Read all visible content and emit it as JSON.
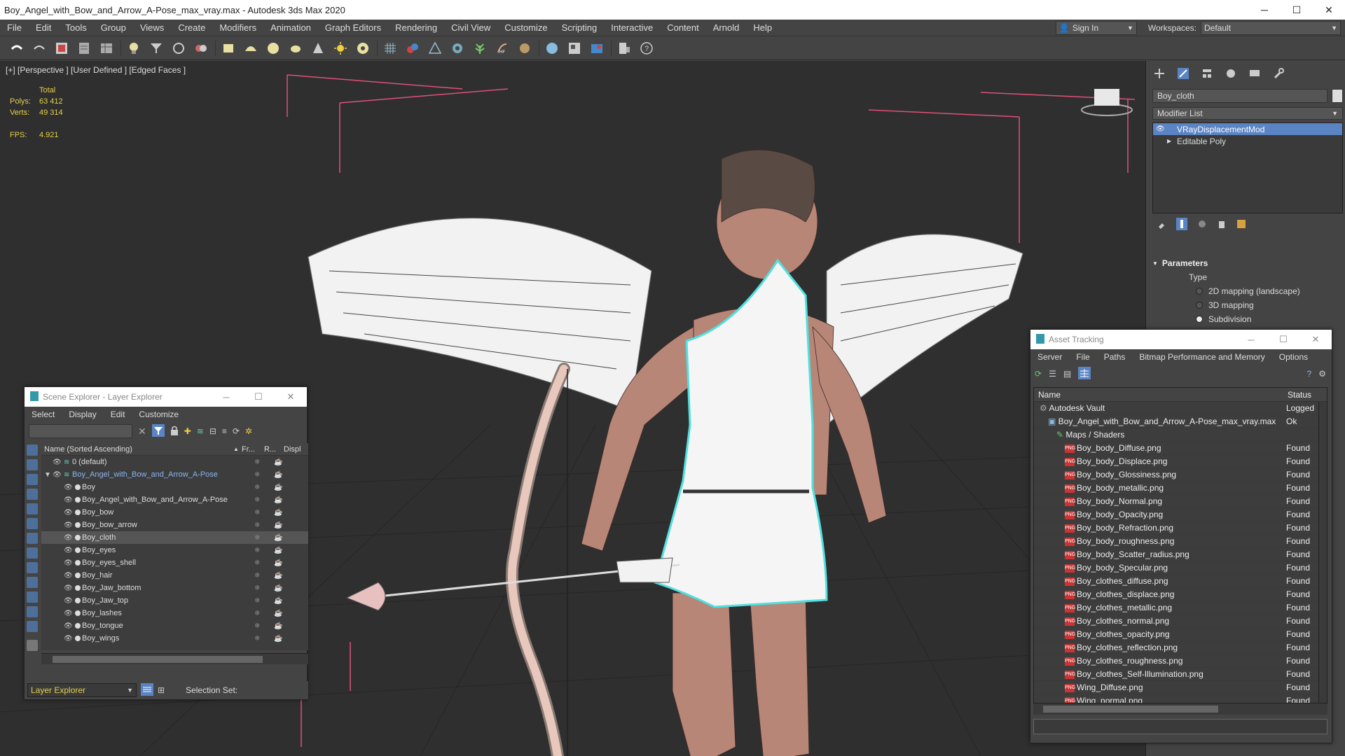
{
  "app": {
    "title": "Boy_Angel_with_Bow_and_Arrow_A-Pose_max_vray.max - Autodesk 3ds Max 2020",
    "minimize": "─",
    "maximize": "☐",
    "close": "✕"
  },
  "menubar": {
    "items": [
      "File",
      "Edit",
      "Tools",
      "Group",
      "Views",
      "Create",
      "Modifiers",
      "Animation",
      "Graph Editors",
      "Rendering",
      "Civil View",
      "Customize",
      "Scripting",
      "Interactive",
      "Content",
      "Arnold",
      "Help"
    ],
    "signin": "Sign In",
    "workspace_label": "Workspaces:",
    "workspace_value": "Default"
  },
  "viewport": {
    "label": "[+] [Perspective ] [User Defined ] [Edged Faces ]",
    "stats_total": "Total",
    "polys_label": "Polys:",
    "polys_value": "63 412",
    "verts_label": "Verts:",
    "verts_value": "49 314",
    "fps_label": "FPS:",
    "fps_value": "4.921"
  },
  "command_panel": {
    "object_name": "Boy_cloth",
    "modifier_list": "Modifier List",
    "stack": [
      "VRayDisplacementMod",
      "Editable Poly"
    ],
    "params_title": "Parameters",
    "type_label": "Type",
    "radios": [
      {
        "label": "2D mapping (landscape)",
        "on": false
      },
      {
        "label": "3D mapping",
        "on": false
      },
      {
        "label": "Subdivision",
        "on": true
      }
    ]
  },
  "scene_explorer": {
    "title": "Scene Explorer - Layer Explorer",
    "menu": [
      "Select",
      "Display",
      "Edit",
      "Customize"
    ],
    "col_name": "Name (Sorted Ascending)",
    "col_fr": "Fr...",
    "col_r": "R...",
    "col_disp": "Displ",
    "rows": [
      {
        "name": "0 (default)",
        "level": 0,
        "type": "layer"
      },
      {
        "name": "Boy_Angel_with_Bow_and_Arrow_A-Pose",
        "level": 0,
        "type": "layer-open"
      },
      {
        "name": "Boy",
        "level": 1,
        "type": "obj"
      },
      {
        "name": "Boy_Angel_with_Bow_and_Arrow_A-Pose",
        "level": 1,
        "type": "obj"
      },
      {
        "name": "Boy_bow",
        "level": 1,
        "type": "obj"
      },
      {
        "name": "Boy_bow_arrow",
        "level": 1,
        "type": "obj"
      },
      {
        "name": "Boy_cloth",
        "level": 1,
        "type": "obj-hl"
      },
      {
        "name": "Boy_eyes",
        "level": 1,
        "type": "obj"
      },
      {
        "name": "Boy_eyes_shell",
        "level": 1,
        "type": "obj"
      },
      {
        "name": "Boy_hair",
        "level": 1,
        "type": "obj"
      },
      {
        "name": "Boy_Jaw_bottom",
        "level": 1,
        "type": "obj"
      },
      {
        "name": "Boy_Jaw_top",
        "level": 1,
        "type": "obj"
      },
      {
        "name": "Boy_lashes",
        "level": 1,
        "type": "obj"
      },
      {
        "name": "Boy_tongue",
        "level": 1,
        "type": "obj"
      },
      {
        "name": "Boy_wings",
        "level": 1,
        "type": "obj"
      }
    ],
    "mode": "Layer Explorer",
    "selection_set": "Selection Set:"
  },
  "asset_tracking": {
    "title": "Asset Tracking",
    "menu": [
      "Server",
      "File",
      "Paths",
      "Bitmap Performance and Memory",
      "Options"
    ],
    "col_name": "Name",
    "col_status": "Status",
    "rows": [
      {
        "name": "Autodesk Vault",
        "status": "Logged",
        "level": 1,
        "icon": "vault"
      },
      {
        "name": "Boy_Angel_with_Bow_and_Arrow_A-Pose_max_vray.max",
        "status": "Ok",
        "level": 2,
        "icon": "max"
      },
      {
        "name": "Maps / Shaders",
        "status": "",
        "level": 3,
        "icon": "maps"
      },
      {
        "name": "Boy_body_Diffuse.png",
        "status": "Found",
        "level": 4,
        "icon": "png"
      },
      {
        "name": "Boy_body_Displace.png",
        "status": "Found",
        "level": 4,
        "icon": "png"
      },
      {
        "name": "Boy_body_Glossiness.png",
        "status": "Found",
        "level": 4,
        "icon": "png"
      },
      {
        "name": "Boy_body_metallic.png",
        "status": "Found",
        "level": 4,
        "icon": "png"
      },
      {
        "name": "Boy_body_Normal.png",
        "status": "Found",
        "level": 4,
        "icon": "png"
      },
      {
        "name": "Boy_body_Opacity.png",
        "status": "Found",
        "level": 4,
        "icon": "png"
      },
      {
        "name": "Boy_body_Refraction.png",
        "status": "Found",
        "level": 4,
        "icon": "png"
      },
      {
        "name": "Boy_body_roughness.png",
        "status": "Found",
        "level": 4,
        "icon": "png"
      },
      {
        "name": "Boy_body_Scatter_radius.png",
        "status": "Found",
        "level": 4,
        "icon": "png"
      },
      {
        "name": "Boy_body_Specular.png",
        "status": "Found",
        "level": 4,
        "icon": "png"
      },
      {
        "name": "Boy_clothes_diffuse.png",
        "status": "Found",
        "level": 4,
        "icon": "png"
      },
      {
        "name": "Boy_clothes_displace.png",
        "status": "Found",
        "level": 4,
        "icon": "png"
      },
      {
        "name": "Boy_clothes_metallic.png",
        "status": "Found",
        "level": 4,
        "icon": "png"
      },
      {
        "name": "Boy_clothes_normal.png",
        "status": "Found",
        "level": 4,
        "icon": "png"
      },
      {
        "name": "Boy_clothes_opacity.png",
        "status": "Found",
        "level": 4,
        "icon": "png"
      },
      {
        "name": "Boy_clothes_reflection.png",
        "status": "Found",
        "level": 4,
        "icon": "png"
      },
      {
        "name": "Boy_clothes_roughness.png",
        "status": "Found",
        "level": 4,
        "icon": "png"
      },
      {
        "name": "Boy_clothes_Self-Illumination.png",
        "status": "Found",
        "level": 4,
        "icon": "png"
      },
      {
        "name": "Wing_Diffuse.png",
        "status": "Found",
        "level": 4,
        "icon": "png"
      },
      {
        "name": "Wing_normal.png",
        "status": "Found",
        "level": 4,
        "icon": "png"
      }
    ]
  },
  "icons": {
    "png_badge": "PNG"
  },
  "colors": {
    "selection": "#5a84c4",
    "stats": "#e5d04a",
    "safe_frame": "#e0507a",
    "cloth_outline": "#4fe0e0"
  }
}
